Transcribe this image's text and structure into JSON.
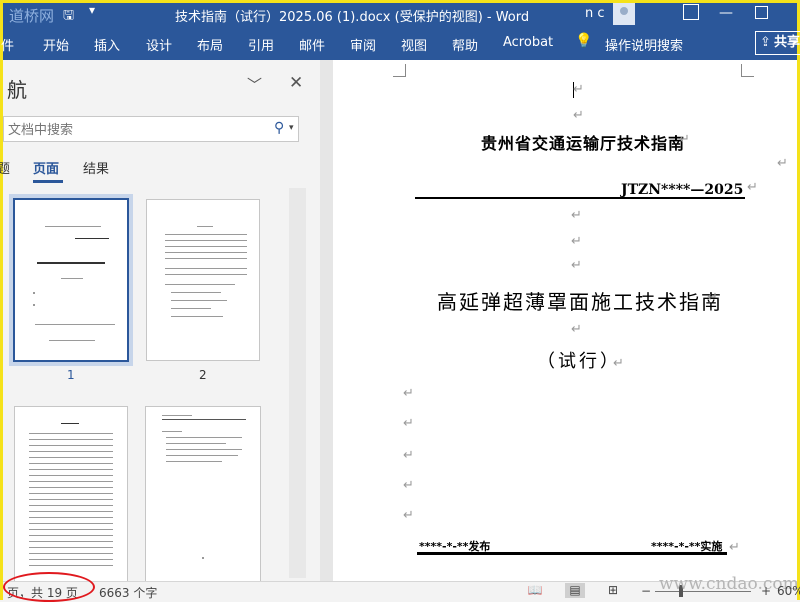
{
  "titlebar": {
    "watermark": "道桥网",
    "save_icon": "save-icon",
    "qa_menu": "▾",
    "document_title": "技术指南（试行）2025.06 (1).docx (受保护的视图) - Word",
    "user_name": "n c",
    "minimize": "—"
  },
  "ribbon": {
    "tabs": [
      "件",
      "开始",
      "插入",
      "设计",
      "布局",
      "引用",
      "邮件",
      "审阅",
      "视图",
      "帮助",
      "Acrobat"
    ],
    "tell_me": "操作说明搜索",
    "share": "共享",
    "color": "#2b579a"
  },
  "navpane": {
    "title": "航",
    "search_placeholder": "文档中搜索",
    "tabs": [
      "题",
      "页面",
      "结果"
    ],
    "active_tab": "页面",
    "thumbnails": [
      {
        "number": "1",
        "selected": true
      },
      {
        "number": "2",
        "selected": false
      },
      {
        "number": "",
        "selected": false
      },
      {
        "number": "",
        "selected": false
      }
    ]
  },
  "document": {
    "paragraph_mark": "↵",
    "agency": "贵州省交通运输厅技术指南",
    "code": "JTZN****—2025",
    "main_title": "高延弹超薄罩面施工技术指南",
    "subtitle": "（试行）",
    "issue_date": "****-*-**发布",
    "impl_date": "****-*-**实施"
  },
  "statusbar": {
    "page_info": "页，共 19 页",
    "word_count": "6663 个字",
    "zoom_minus": "−",
    "zoom_plus": "+",
    "zoom_level": "60%",
    "watermark_site": "www.cndao.com"
  }
}
